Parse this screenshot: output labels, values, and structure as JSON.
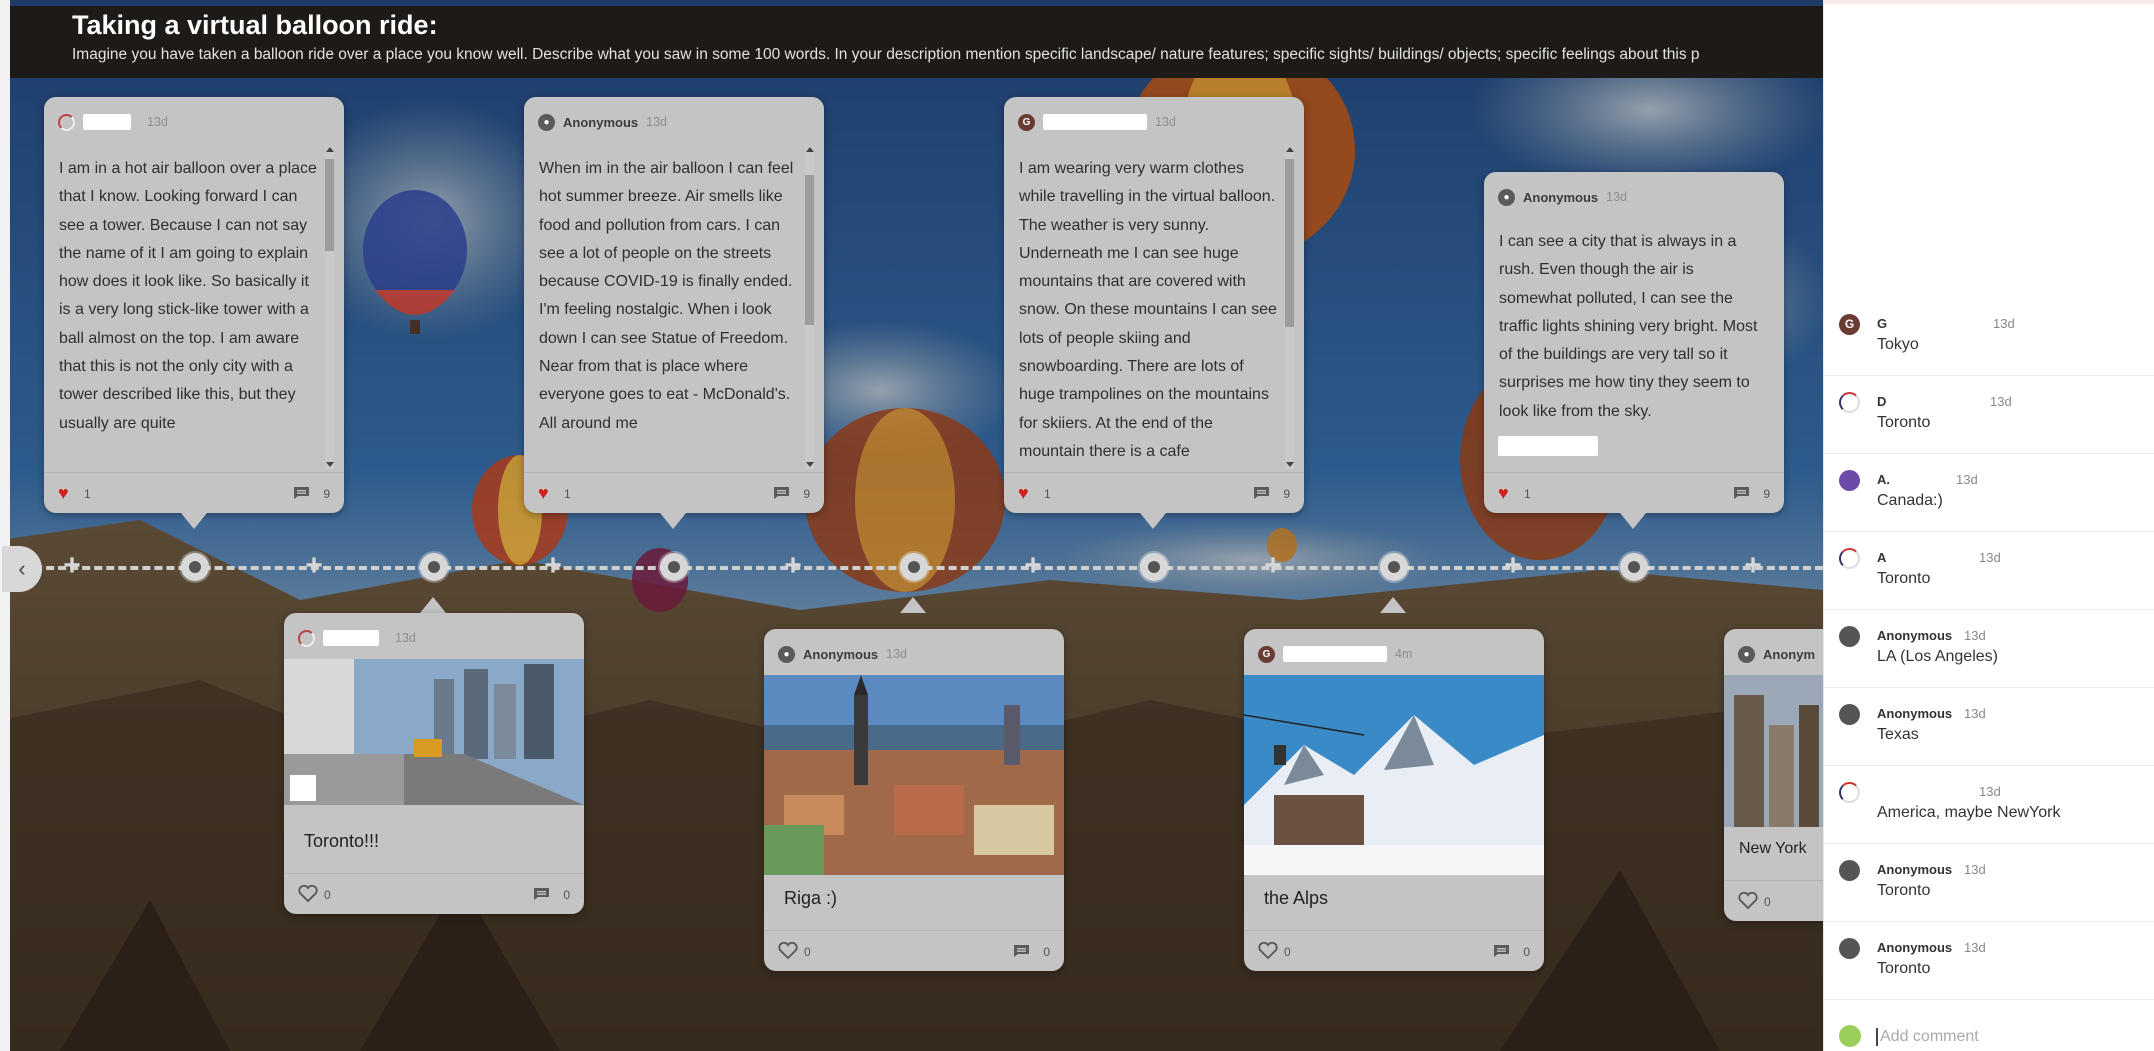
{
  "board": {
    "title": "Taking a virtual balloon ride:",
    "description": "Imagine you have taken a balloon ride over a place you know well. Describe what you saw in some 100 words. In your description mention specific landscape/ nature features; specific sights/ buildings/ objects; specific feelings about this p"
  },
  "nav": {
    "prev_symbol": "‹"
  },
  "text_posts": [
    {
      "author": "",
      "time": "13d",
      "body": "I am in a hot air balloon over a place that I know. Looking forward I can see a tower. Because I can not say the name of it I am going to explain how does it look like. So basically it is a very long stick-like tower with a ball almost on the top. I am aware that this is not the only city with a tower described like this, but they usually are quite",
      "likes": "1",
      "comments": "9"
    },
    {
      "author": "Anonymous",
      "time": "13d",
      "body": "When im in the air balloon I can feel hot summer breeze. Air smells like food and pollution from cars. I can see a lot of people on the streets because COVID-19 is finally ended. I'm feeling nostalgic. When i look down I can see Statue of Freedom.  Near from that is place where everyone goes to eat - McDonald's. All around me",
      "likes": "1",
      "comments": "9"
    },
    {
      "author": "G",
      "time": "13d",
      "body": "I am wearing very warm clothes while travelling in the virtual balloon. The weather is very sunny. Underneath me I can see huge mountains that are covered with snow. On these mountains I can see lots of people skiing and snowboarding. There are lots of huge trampolines on the mountains for skiiers. At the end of the mountain there is a cafe",
      "likes": "1",
      "comments": "9"
    },
    {
      "author": "Anonymous",
      "time": "13d",
      "body": "I can see a city that is always in a rush. Even though the air is somewhat polluted, I can see the traffic lights shining very bright. Most of the buildings are very tall so it surprises me how tiny they seem to look like from the sky.",
      "likes": "1",
      "comments": "9"
    }
  ],
  "image_posts": [
    {
      "author": "",
      "time": "13d",
      "caption": "Toronto!!!",
      "likes": "0",
      "comments": "0"
    },
    {
      "author": "Anonymous",
      "time": "13d",
      "caption": "Riga :)",
      "likes": "0",
      "comments": "0"
    },
    {
      "author": "G",
      "time": "4m",
      "caption": "the Alps",
      "likes": "0",
      "comments": "0"
    },
    {
      "author": "Anonym",
      "time": "",
      "caption": "New York",
      "likes": "0",
      "comments": ""
    }
  ],
  "comments": [
    {
      "name": "G",
      "time": "13d",
      "text": "Tokyo",
      "avatar": "letter",
      "letter": "G"
    },
    {
      "name": "D",
      "time": "13d",
      "text": "Toronto",
      "avatar": "ring"
    },
    {
      "name": "A.",
      "time": "13d",
      "text": "Canada:)",
      "avatar": "purple"
    },
    {
      "name": "A",
      "time": "13d",
      "text": "Toronto",
      "avatar": "ring"
    },
    {
      "name": "Anonymous",
      "time": "13d",
      "text": "LA (Los Angeles)",
      "avatar": "anon"
    },
    {
      "name": "Anonymous",
      "time": "13d",
      "text": "Texas",
      "avatar": "anon"
    },
    {
      "name": "",
      "time": "13d",
      "text": "America, maybe NewYork",
      "avatar": "ring"
    },
    {
      "name": "Anonymous",
      "time": "13d",
      "text": "Toronto",
      "avatar": "anon"
    },
    {
      "name": "Anonymous",
      "time": "13d",
      "text": "Toronto",
      "avatar": "anon"
    }
  ],
  "add_comment": {
    "placeholder": "Add comment"
  },
  "colors": {
    "heart": "#d02020",
    "card": "#c4c4c4",
    "topbar": "#1d1a17"
  }
}
